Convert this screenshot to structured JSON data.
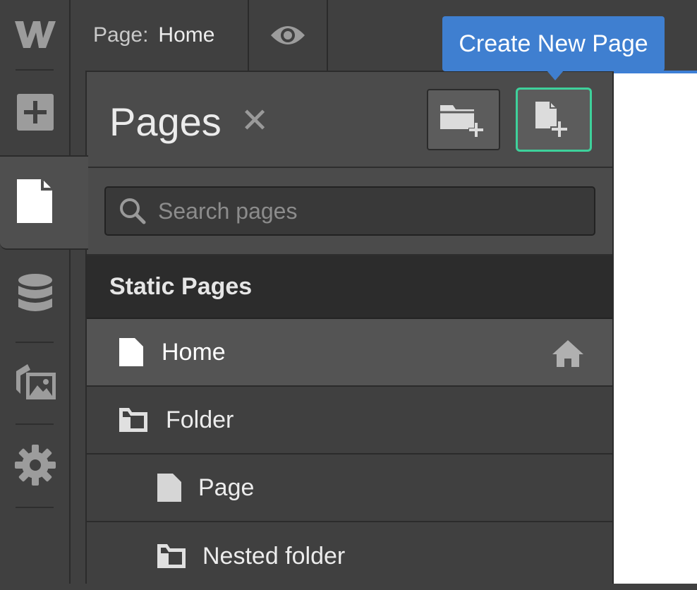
{
  "topbar": {
    "page_label": "Page:",
    "page_name": "Home"
  },
  "tooltip": {
    "text": "Create New Page"
  },
  "panel": {
    "title": "Pages",
    "close_symbol": "✕",
    "search_placeholder": "Search pages",
    "section_label": "Static Pages",
    "items": [
      {
        "label": "Home",
        "icon": "page-icon",
        "selected": true,
        "home": true
      },
      {
        "label": "Folder",
        "icon": "folder-icon"
      },
      {
        "label": "Page",
        "icon": "page-icon"
      },
      {
        "label": "Nested folder",
        "icon": "folder-icon"
      }
    ]
  },
  "rail": {
    "icons": [
      "webflow-logo",
      "add-icon",
      "pages-icon",
      "cms-database-icon",
      "assets-icon",
      "settings-gear-icon"
    ]
  },
  "colors": {
    "accent_blue": "#3f7fd0",
    "highlight_green": "#3ed19b",
    "panel_bg": "#4b4b4b",
    "rail_bg": "#404040"
  }
}
